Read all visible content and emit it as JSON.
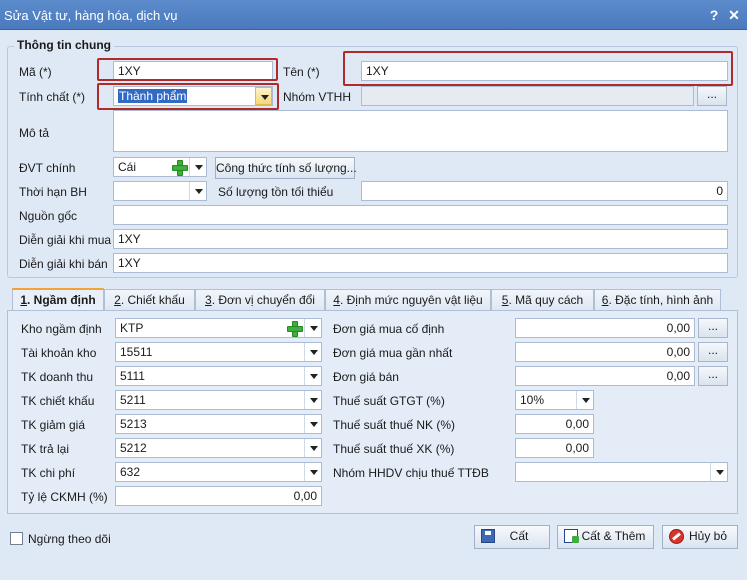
{
  "window": {
    "title": "Sửa Vật tư, hàng hóa, dịch vụ",
    "help": "?",
    "close": "✕"
  },
  "general": {
    "section_title": "Thông tin chung",
    "ma_label": "Mã (*)",
    "ma_value": "1XY",
    "ten_label": "Tên (*)",
    "ten_value": "1XY",
    "tinh_chat_label": "Tính chất (*)",
    "tinh_chat_value": "Thành phẩm",
    "nhom_label": "Nhóm VTHH",
    "nhom_button": "...",
    "mo_ta_label": "Mô tả",
    "mo_ta_value": "",
    "dvt_label": "ĐVT chính",
    "dvt_value": "Cái",
    "cong_thuc_button": "Công thức tính số lượng...",
    "thoi_han_label": "Thời hạn BH",
    "thoi_han_value": "",
    "so_luong_label": "Số lượng tồn tối thiểu",
    "so_luong_value": "0",
    "nguon_goc_label": "Nguồn gốc",
    "nguon_goc_value": "",
    "dien_giai_mua_label": "Diễn giải khi mua",
    "dien_giai_mua_value": "1XY",
    "dien_giai_ban_label": "Diễn giải khi bán",
    "dien_giai_ban_value": "1XY"
  },
  "tabs": [
    {
      "key": "1",
      "label": ". Ngầm định"
    },
    {
      "key": "2",
      "label": ". Chiết khấu"
    },
    {
      "key": "3",
      "label": ". Đơn vị chuyển đổi"
    },
    {
      "key": "4",
      "label": ". Định mức nguyên vật liệu"
    },
    {
      "key": "5",
      "label": ". Mã quy cách"
    },
    {
      "key": "6",
      "label": ". Đặc tính, hình ảnh"
    }
  ],
  "defaults": {
    "kho_label": "Kho ngầm định",
    "kho_value": "KTP",
    "tk_kho_label": "Tài khoản kho",
    "tk_kho_value": "15511",
    "tk_dt_label": "TK doanh thu",
    "tk_dt_value": "5111",
    "tk_ck_label": "TK chiết khấu",
    "tk_ck_value": "5211",
    "tk_gg_label": "TK giảm giá",
    "tk_gg_value": "5213",
    "tk_tl_label": "TK trả lại",
    "tk_tl_value": "5212",
    "tk_cp_label": "TK chi phí",
    "tk_cp_value": "632",
    "ckmh_label": "Tỷ lệ CKMH (%)",
    "ckmh_value": "0,00",
    "dg_co_dinh_label": "Đơn giá mua cố định",
    "dg_co_dinh_value": "0,00",
    "dg_gan_nhat_label": "Đơn giá mua gần nhất",
    "dg_gan_nhat_value": "0,00",
    "dg_ban_label": "Đơn giá bán",
    "dg_ban_value": "0,00",
    "gtgt_label": "Thuế suất GTGT (%)",
    "gtgt_value": "10%",
    "nk_label": "Thuế suất thuế NK (%)",
    "nk_value": "0,00",
    "xk_label": "Thuế suất thuế XK (%)",
    "xk_value": "0,00",
    "ttdb_label": "Nhóm HHDV chịu thuế TTĐB",
    "ttdb_value": "",
    "ellipsis": "..."
  },
  "footer": {
    "ngung_label": "Ngừng theo dõi",
    "cat_label": "Cất",
    "cat_them_label": "Cất & Thêm",
    "huy_label": "Hủy bỏ"
  }
}
